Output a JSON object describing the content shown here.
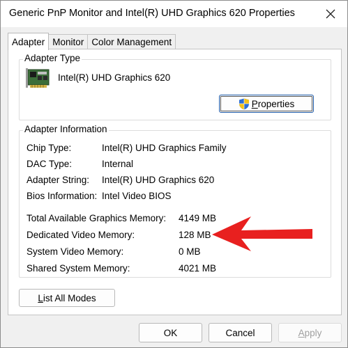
{
  "window": {
    "title": "Generic PnP Monitor and Intel(R) UHD Graphics 620 Properties"
  },
  "tabs": [
    {
      "label": "Adapter",
      "active": true
    },
    {
      "label": "Monitor",
      "active": false
    },
    {
      "label": "Color Management",
      "active": false
    }
  ],
  "adapter_type": {
    "group_label": "Adapter Type",
    "name": "Intel(R) UHD Graphics 620",
    "properties_label": "Properties"
  },
  "adapter_info": {
    "group_label": "Adapter Information",
    "rows": [
      {
        "label": "Chip Type:",
        "value": "Intel(R) UHD Graphics Family"
      },
      {
        "label": "DAC Type:",
        "value": "Internal"
      },
      {
        "label": "Adapter String:",
        "value": "Intel(R) UHD Graphics 620"
      },
      {
        "label": "Bios Information:",
        "value": "Intel Video BIOS"
      }
    ],
    "memory": [
      {
        "label": "Total Available Graphics Memory:",
        "value": "4149 MB"
      },
      {
        "label": "Dedicated Video Memory:",
        "value": "128 MB"
      },
      {
        "label": "System Video Memory:",
        "value": "0 MB"
      },
      {
        "label": "Shared System Memory:",
        "value": "4021 MB"
      }
    ]
  },
  "buttons": {
    "list_all_modes": "List All Modes",
    "ok": "OK",
    "cancel": "Cancel",
    "apply": "Apply"
  },
  "colors": {
    "arrow": "#e8201f",
    "focus_border": "#1e5aa8"
  }
}
